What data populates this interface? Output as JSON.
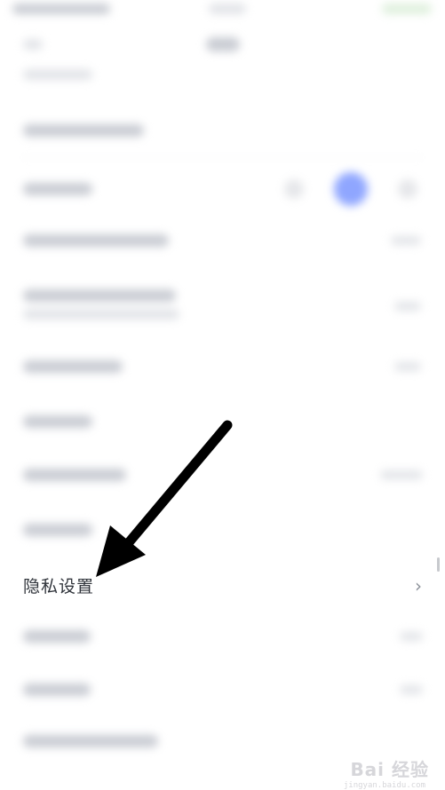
{
  "settings": {
    "privacy_label": "隐私设置",
    "chevron_glyph": "›"
  },
  "watermark": {
    "brand": "Bai 经验",
    "url": "jingyan.baidu.com"
  },
  "colors": {
    "accent_toggle": "#8fa6ff",
    "arrow": "#000000"
  }
}
